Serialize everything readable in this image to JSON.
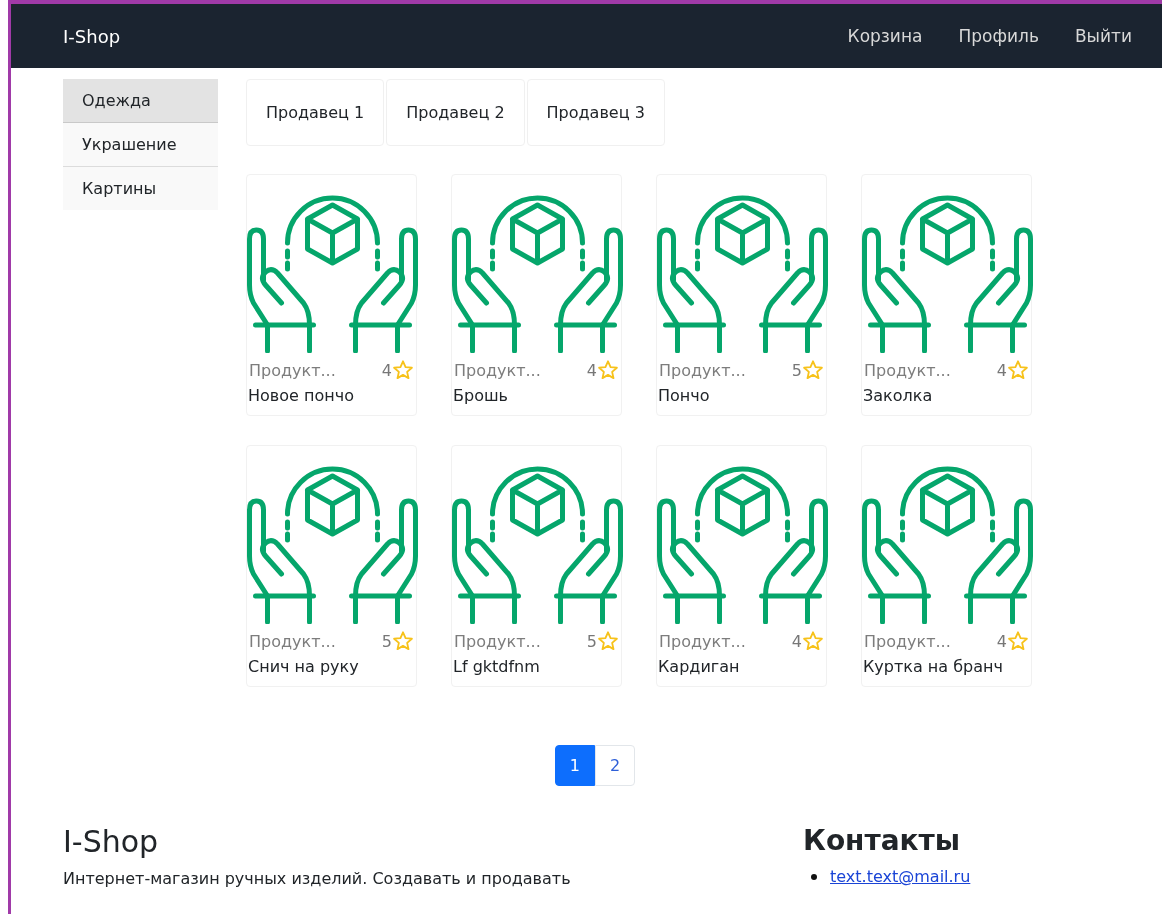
{
  "navbar": {
    "brand": "I-Shop",
    "links": [
      "Корзина",
      "Профиль",
      "Выйти"
    ]
  },
  "sidebar": {
    "items": [
      {
        "label": "Одежда",
        "selected": true
      },
      {
        "label": "Украшение",
        "selected": false
      },
      {
        "label": "Картины",
        "selected": false
      }
    ]
  },
  "seller_tabs": [
    "Продавец 1",
    "Продавец 2",
    "Продавец 3"
  ],
  "products": [
    {
      "category": "Продукт...",
      "rating": "4",
      "name": "Новое пончо"
    },
    {
      "category": "Продукт...",
      "rating": "4",
      "name": "Брошь"
    },
    {
      "category": "Продукт...",
      "rating": "5",
      "name": "Пончо"
    },
    {
      "category": "Продукт...",
      "rating": "4",
      "name": "Заколка"
    },
    {
      "category": "Продукт...",
      "rating": "5",
      "name": "Снич на руку"
    },
    {
      "category": "Продукт...",
      "rating": "5",
      "name": "Lf gktdfnm"
    },
    {
      "category": "Продукт...",
      "rating": "4",
      "name": "Кардиган"
    },
    {
      "category": "Продукт...",
      "rating": "4",
      "name": "Куртка на бранч"
    }
  ],
  "pagination": [
    {
      "label": "1",
      "selected": true
    },
    {
      "label": "2",
      "selected": false
    }
  ],
  "footer": {
    "title": "I-Shop",
    "description": "Интернет-магазин ручных изделий. Создавать и продавать",
    "contacts_title": "Контакты",
    "contacts": [
      "text.text@mail.ru"
    ]
  }
}
